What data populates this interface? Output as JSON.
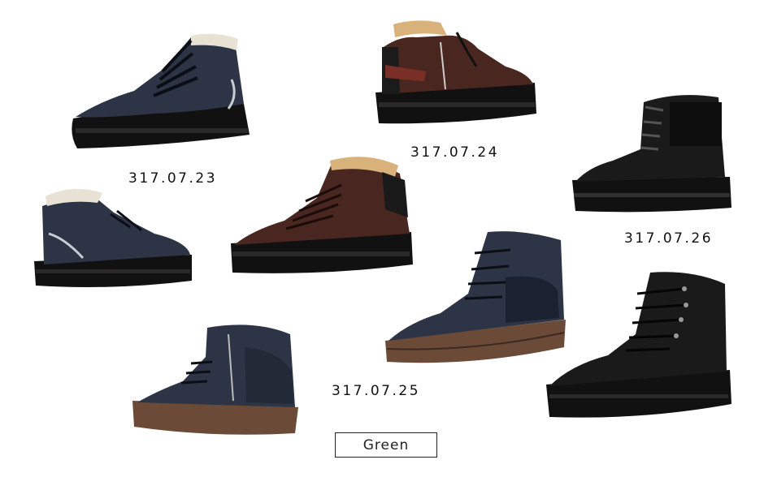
{
  "products": [
    {
      "code": "317.07.23",
      "color": "navy leather",
      "fur_lining": true
    },
    {
      "code": "317.07.24",
      "color": "dark brown suede",
      "fur_lining": true
    },
    {
      "code": "317.07.25",
      "color": "navy suede",
      "fur_lining": false
    },
    {
      "code": "317.07.26",
      "color": "black leather",
      "fur_lining": false
    }
  ],
  "brand_label": "Green",
  "colors": {
    "navy": "#2c3445",
    "brown_suede": "#4a2620",
    "black": "#1a1a1a",
    "fur": "#d8b27a",
    "brown_sole": "#6b4a38"
  }
}
